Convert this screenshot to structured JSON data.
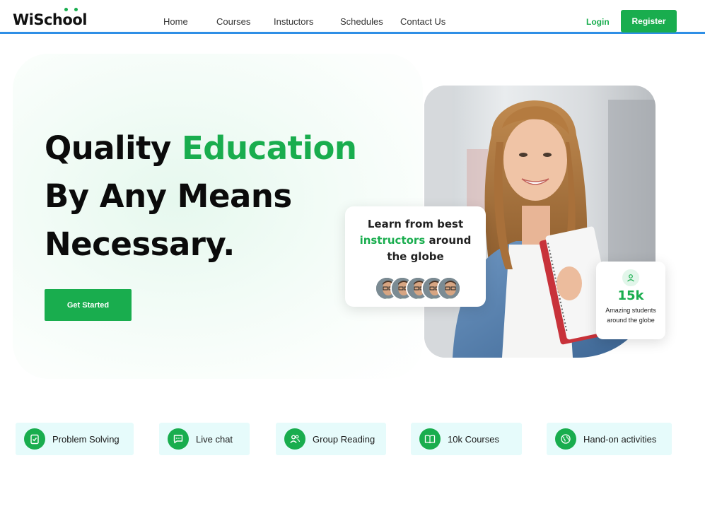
{
  "brand": {
    "name_prefix": "WiSch",
    "name_o1": "o",
    "name_o2": "o",
    "name_suffix": "l",
    "accent": "#19ad4e",
    "nav_border": "#2f8fe6"
  },
  "nav": {
    "links": [
      "Home",
      "Courses",
      "Instuctors",
      "Schedules",
      "Contact Us"
    ],
    "login": "Login",
    "register": "Register"
  },
  "hero": {
    "line1_a": "Quality ",
    "line1_b": "Education",
    "line2": "By Any Means",
    "line3": "Necessary.",
    "cta": "Get Started"
  },
  "instructor_card": {
    "line1": "Learn from best",
    "line2_green": "instructors",
    "line2_rest": " around",
    "line3": "the globe",
    "avatar_count": 5
  },
  "stats_card": {
    "icon": "user-icon",
    "value": "15k",
    "label": "Amazing students around the globe"
  },
  "features": [
    {
      "label": "Problem Solving",
      "icon": "clipboard-check-icon"
    },
    {
      "label": "Live chat",
      "icon": "chat-icon"
    },
    {
      "label": "Group Reading",
      "icon": "users-icon"
    },
    {
      "label": "10k Courses",
      "icon": "book-open-icon"
    },
    {
      "label": "Hand-on activities",
      "icon": "globe-icon"
    }
  ]
}
